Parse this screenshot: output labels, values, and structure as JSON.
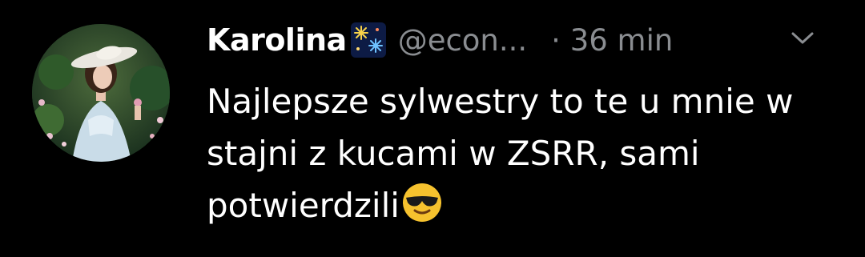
{
  "tweet": {
    "author_name": "Karolina",
    "name_emoji": "fireworks-emoji",
    "handle": "@econ...",
    "time": "· 36 min",
    "text": "Najlepsze sylwestry to te u mnie w stajni z kucami w ZSRR, sami potwierdzili",
    "text_emoji": "sunglasses-smiley-emoji",
    "menu_icon": "chevron-down-icon"
  },
  "colors": {
    "background": "#000000",
    "primary_text": "#ffffff",
    "secondary_text": "#8a8d91"
  }
}
